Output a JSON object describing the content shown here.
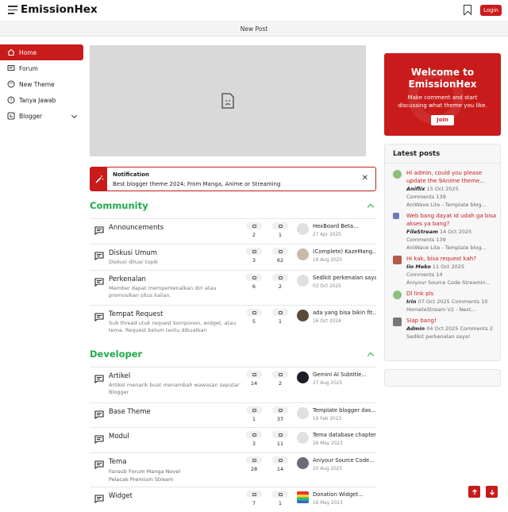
{
  "header": {
    "title": "EmissionHex",
    "login_label": "Login",
    "new_post": "New Post"
  },
  "sidebar": {
    "items": [
      {
        "label": "Home",
        "icon": "home-icon"
      },
      {
        "label": "Forum",
        "icon": "chat-icon"
      },
      {
        "label": "New Theme",
        "icon": "palette-icon"
      },
      {
        "label": "Tanya Jawab",
        "icon": "help-icon"
      },
      {
        "label": "Blogger",
        "icon": "blogger-icon"
      }
    ]
  },
  "notification": {
    "title": "Notification",
    "text": "Best blogger theme 2024: From Manga, Anime or Streaming"
  },
  "community": {
    "title": "Community",
    "rows": [
      {
        "title": "Announcements",
        "desc": "",
        "topics": "2",
        "posts": "1",
        "last_title": "HexBoard Beta...",
        "last_date": "27 Apr 2025"
      },
      {
        "title": "Diskusi Umum",
        "desc": "Diskusi diluar topik",
        "topics": "3",
        "posts": "62",
        "last_title": "(Complete) KazeMang...",
        "last_date": "16 Aug 2025"
      },
      {
        "title": "Perkenalan",
        "desc": "Member dapat memperkenalkan diri atau promosikan situs kalian.",
        "topics": "6",
        "posts": "2",
        "last_title": "Sedikit perkenalan saya!",
        "last_date": "03 Oct 2025"
      },
      {
        "title": "Tempat Request",
        "desc": "Sub thread utuk request komponen, widget, atau tema. Request belum tentu dibuatkan",
        "topics": "5",
        "posts": "1",
        "last_title": "ada yang bisa bikin fit...",
        "last_date": "16 Oct 2024"
      }
    ]
  },
  "developer": {
    "title": "Developer",
    "rows": [
      {
        "title": "Artikel",
        "desc": "Artikel menarik buat menambah wawasan seputar Blogger",
        "topics": "14",
        "posts": "2",
        "last_title": "Gemini AI Subtitle...",
        "last_date": "27 Aug 2025"
      },
      {
        "title": "Base Theme",
        "desc": "",
        "topics": "1",
        "posts": "37",
        "last_title": "Template blogger das...",
        "last_date": "19 Feb 2023"
      },
      {
        "title": "Modul",
        "desc": "",
        "topics": "3",
        "posts": "11",
        "last_title": "Tema database chapter",
        "last_date": "26 May 2023"
      },
      {
        "title": "Tema",
        "tags_line1": "Fansub  Forum  Manga  Novel",
        "tags_line2": "Pelacak  Premium  Stream",
        "topics": "28",
        "posts": "14",
        "last_title": "Aniyour Source Code...",
        "last_date": "20 Aug 2025"
      },
      {
        "title": "Widget",
        "desc": "",
        "topics": "7",
        "posts": "1",
        "last_title": "Donation Widget...",
        "last_date": "16 May 2023"
      }
    ]
  },
  "welcome": {
    "title_line1": "Welcome to",
    "title_line2": "EmissionHex",
    "sub_line1": "Make comment and start",
    "sub_line2": "discussing what theme you like.",
    "join": "Join"
  },
  "latest": {
    "title": "Latest posts",
    "posts": [
      {
        "q1": "Hi admin, could you please",
        "q2": "update the 9Anime theme...",
        "author": "Aniflix",
        "date": "15 Oct 2025",
        "comments": "Comments 139",
        "topic": "AniWave Lite - Template blog..."
      },
      {
        "q1": "Web bang dayat id udah ga bisa",
        "q2": "akses ya bang?",
        "author": "FileStream",
        "date": "14 Oct 2025",
        "comments": "Comments 139",
        "topic": "AniWave Lite - Template blog..."
      },
      {
        "q1": "Hi kak, bisa request kah?",
        "q2": "",
        "author": "Iio Meko",
        "date": "11 Oct 2025",
        "comments": "Comments 14",
        "topic": "Aniyour Source Code Streamin..."
      },
      {
        "q1": "Dl link pls",
        "q2": "",
        "author": "Irin",
        "date": "07 Oct 2025 Comments 10",
        "comments": "",
        "topic": "HometeStream V2 - Next..."
      },
      {
        "q1": "Siap bang!",
        "q2": "",
        "author": "Admin",
        "date": "04 Oct 2025 Comments 2",
        "comments": "",
        "topic": "Sedikit perkenalan saya!"
      }
    ]
  },
  "colors": {
    "accent": "#c91b1b",
    "section": "#1faa4b"
  }
}
